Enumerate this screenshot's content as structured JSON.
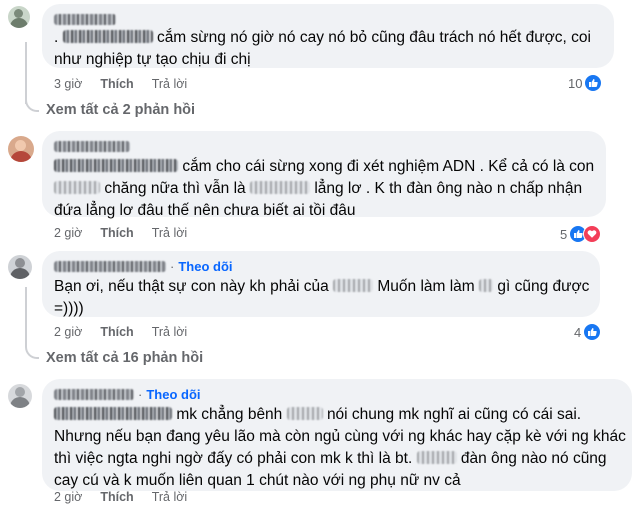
{
  "comments": [
    {
      "author": "",
      "line1": "cắm sừng nó giờ nó cay nó bỏ cũng đâu trách nó hết được, coi",
      "line2": "như nghiệp tự tạo chịu đi chị",
      "time": "3 giờ",
      "like": "Thích",
      "reply": "Trả lời",
      "reaction_count": "10"
    },
    {
      "author": "",
      "line1": "cắm cho cái sừng xong đi xét nghiệm ADN . Kể cả có là con",
      "line2a": "chăng nữa thì vẫn là",
      "line2b": "lẳng lơ . K th đàn ông nào n chấp nhận",
      "line3": "đứa lẳng lơ đâu thế nên chưa biết ai tồi đâu",
      "time": "2 giờ",
      "like": "Thích",
      "reply": "Trả lời",
      "reaction_count": "5"
    },
    {
      "author": "",
      "follow": "Theo dõi",
      "line1a": "Bạn ơi, nếu thật sự con này kh phải của",
      "line1b": "Muốn làm làm",
      "line1c": "gì cũng được",
      "line2": "=))))",
      "time": "2 giờ",
      "like": "Thích",
      "reply": "Trả lời",
      "reaction_count": "4"
    },
    {
      "author": "",
      "follow": "Theo dõi",
      "line1a": "mk chẳng bênh",
      "line1b": "nói chung mk nghĩ ai cũng có cái sai.",
      "line2": "Nhưng nếu bạn đang yêu lão mà còn ngủ cùng với ng khác hay cặp kè với ng khác",
      "line3a": "thì việc ngta nghi ngờ đấy có phải con mk k thì là bt.",
      "line3b": "đàn ông nào nó cũng",
      "line4": "cay cú và k muốn liên quan 1 chút nào với ng phụ nữ nv cả",
      "time": "2 giờ",
      "like": "Thích",
      "reply": "Trả lời"
    }
  ],
  "view_replies_1": "Xem tất cả 2 phản hồi",
  "view_replies_2": "Xem tất cả 16 phản hồi",
  "icons": [
    "like-reaction-icon",
    "love-reaction-icon",
    "avatar"
  ],
  "colors": {
    "bubble": "#f0f2f5",
    "link": "#0866ff",
    "meta": "#65676b",
    "like": "#1877f2",
    "love": "#f33e58"
  }
}
